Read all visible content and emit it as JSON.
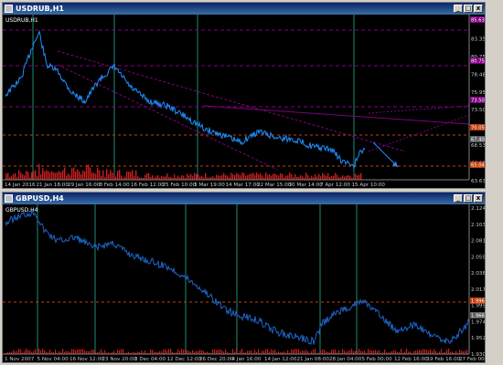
{
  "top_window": {
    "title": "USDRUB,H1",
    "symbol_label": "USDRUB,H1",
    "price_labels": [
      "85.630",
      "83.350",
      "80.750",
      "78.480",
      "75.950",
      "73.500",
      "70.980",
      "68.530",
      "66.080",
      "63.630"
    ],
    "highlight_labels": [
      {
        "text": "85.630",
        "color": "#800080"
      },
      {
        "text": "80.750",
        "color": "#800080"
      },
      {
        "text": "73.500",
        "color": "#800080"
      },
      {
        "text": "70.051",
        "color": "#c04010"
      },
      {
        "text": "67.403",
        "color": "#606060"
      },
      {
        "text": "65.044",
        "color": "#c04010"
      }
    ],
    "time_labels": [
      "14 Jan 2016",
      "21 Jan 18:00",
      "29 Jan 16:00",
      "8 Feb 14:00",
      "16 Feb 12:00",
      "25 Feb 10:00",
      "3 Mar 19:00",
      "14 Mar 17:00",
      "22 Mar 15:00",
      "30 Mar 14:00",
      "7 Apr 12:00",
      "15 Apr 10:00"
    ]
  },
  "bottom_window": {
    "title": "GBPUSD,H4",
    "symbol_label": "GBPUSD,H4",
    "price_labels": [
      "2.12470",
      "2.10310",
      "2.08150",
      "2.05990",
      "2.03830",
      "2.01730",
      "1.99520",
      "1.97410",
      "1.95250",
      "1.93090"
    ],
    "highlight_labels": [
      {
        "text": "1.99623",
        "color": "#c04010"
      },
      {
        "text": "1.96640",
        "color": "#606060"
      }
    ],
    "time_labels": [
      "1 Nov 2007",
      "5 Nov 04:00",
      "16 Nov 12:00",
      "23 Nov 20:00",
      "3 Dec 04:00",
      "12 Dec 12:00",
      "26 Dec 20:00",
      "4 Jan 16:00",
      "14 Jan 12:00",
      "21 Jan 08:00",
      "28 Jan 04:00",
      "5 Feb 00:00",
      "12 Feb 16:00",
      "19 Feb 16:00",
      "27 Feb 00"
    ]
  },
  "colors": {
    "background": "#000000",
    "price_line_top": "#1e90ff",
    "price_line_bottom": "#1e64c8",
    "volume": "#c81e1e",
    "vertical_marker": "#1f8a7a",
    "level_line": "#c04010",
    "trend_line": "#800080"
  },
  "icons": {
    "chart_window_icon": "chart-icon",
    "minimize": "minimize-icon",
    "maximize": "maximize-icon",
    "close": "close-icon"
  },
  "window_buttons": {
    "minimize": "_",
    "maximize": "□",
    "close": "x"
  }
}
